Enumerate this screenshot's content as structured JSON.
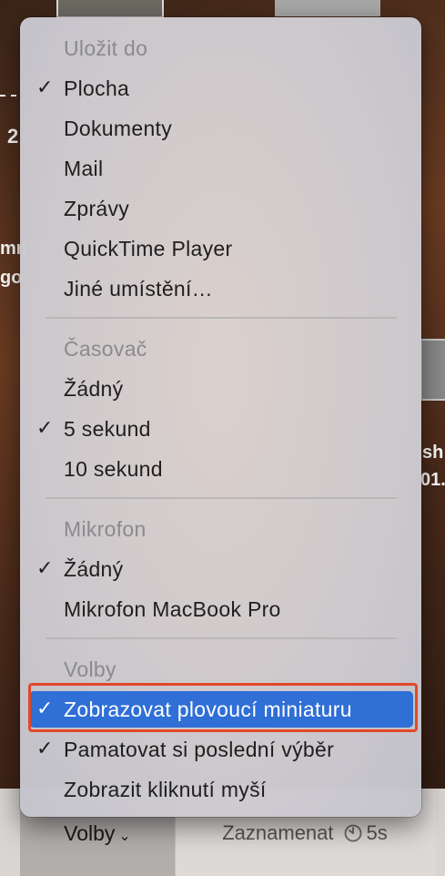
{
  "background": {
    "fragments": [
      "2",
      "mn",
      "go",
      "sh",
      "01."
    ]
  },
  "menu": {
    "sections": [
      {
        "header": "Uložit do",
        "items": [
          {
            "label": "Plocha",
            "checked": true
          },
          {
            "label": "Dokumenty",
            "checked": false
          },
          {
            "label": "Mail",
            "checked": false
          },
          {
            "label": "Zprávy",
            "checked": false
          },
          {
            "label": "QuickTime Player",
            "checked": false
          },
          {
            "label": "Jiné umístění…",
            "checked": false
          }
        ]
      },
      {
        "header": "Časovač",
        "items": [
          {
            "label": "Žádný",
            "checked": false
          },
          {
            "label": "5 sekund",
            "checked": true
          },
          {
            "label": "10 sekund",
            "checked": false
          }
        ]
      },
      {
        "header": "Mikrofon",
        "items": [
          {
            "label": "Žádný",
            "checked": true
          },
          {
            "label": "Mikrofon MacBook Pro",
            "checked": false
          }
        ]
      },
      {
        "header": "Volby",
        "items": [
          {
            "label": "Zobrazovat plovoucí miniaturu",
            "checked": true,
            "highlighted": true
          },
          {
            "label": "Pamatovat si poslední výběr",
            "checked": true
          },
          {
            "label": "Zobrazit kliknutí myší",
            "checked": false
          }
        ]
      }
    ],
    "check_glyph": "✓"
  },
  "toolbar": {
    "options_label": "Volby",
    "options_chevron": "⌄",
    "record_label": "Zaznamenat",
    "timer_icon": "timer-icon",
    "timer_value": "5s"
  },
  "colors": {
    "selection": "#2f6fd6",
    "annotation_border": "#e2482a"
  }
}
